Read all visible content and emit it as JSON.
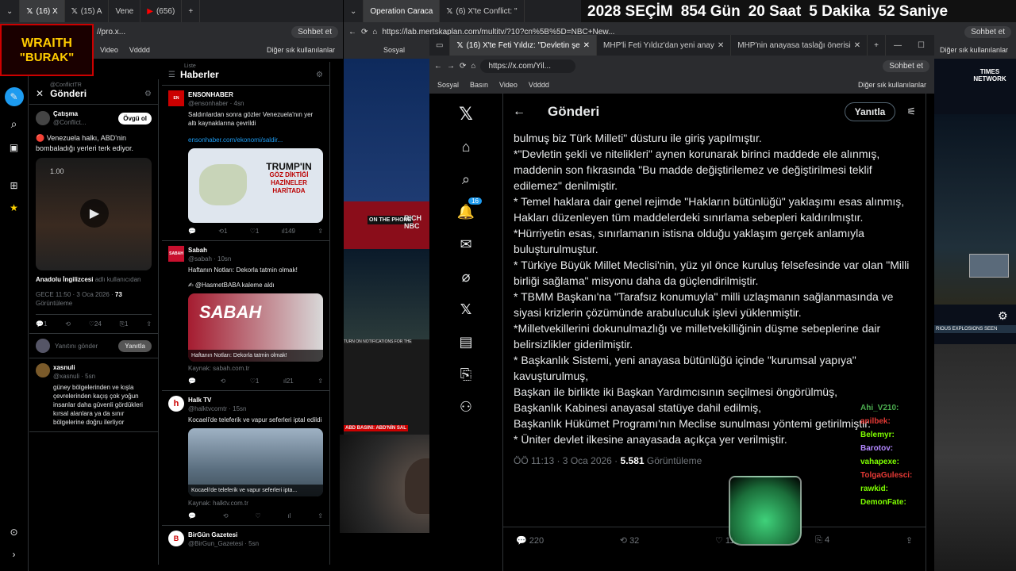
{
  "countdown": {
    "year_label": "2028 SEÇİM",
    "days": "854 Gün",
    "hours": "20 Saat",
    "minutes": "5 Dakika",
    "seconds": "52 Saniye"
  },
  "overlay_logo": {
    "line1": "WRAITH",
    "line2": "\"BURAK\""
  },
  "left_browser": {
    "tabs": [
      "(16) X",
      "(15) A",
      "Vene",
      "(656)"
    ],
    "address": "//pro.x...",
    "chat_button": "Sohbet et",
    "bookmarks": [
      "Video",
      "Vdddd",
      "Diğer sık kullanılanlar"
    ]
  },
  "col1": {
    "header": "Gönderi",
    "top_handle": "@ConflictTR",
    "tweet": {
      "name": "Çatışma",
      "handle": "@Conflict...",
      "follow": "Övgü ol",
      "text": "🔴 Venezuela halkı, ABD'nin bombaladığı yerleri terk ediyor.",
      "video_time": "1.00",
      "credit_name": "Anadolu İngilizcesi",
      "credit_rest": "adlı kullanıcıdan",
      "time": "GECE 11:50 · 3 Oca 2026 · ",
      "views": "73",
      "views_label": "Görüntüleme",
      "reply": "1",
      "like": "24",
      "save": "1"
    },
    "reply_box": {
      "placeholder": "Yanıtını gönder",
      "button": "Yanıtla"
    },
    "reply": {
      "name": "xasnuli",
      "handle": "@xasnuli · 5sn",
      "text": "güney bölgelerinden ve kışla çevrelerinden kaçış çok yoğun insanlar daha güvenli gördükleri kırsal alanlara ya da sınır bölgelerine doğru ilerliyor"
    }
  },
  "col2": {
    "small_label": "Liste",
    "header": "Haberler",
    "tweets": [
      {
        "name": "ENSONHABER",
        "handle": "@ensonhaber · 4sn",
        "text": "Saldırılardan sonra gözler Venezuela'nın yer altı kaynaklarına çevrildi",
        "link": "ensonhaber.com/ekonomi/saldir...",
        "img_text1": "TRUMP'IN",
        "img_text2": "GÖZ DİKTİĞİ HAZİNELER HARİTADA",
        "reply": "1",
        "like": "1",
        "views": "149"
      },
      {
        "name": "Sabah",
        "handle": "@sabah · 10sn",
        "text": "Haftanın Notları: Dekorla tatmin olmak!",
        "mention": "✍ @HasmetBABA kaleme aldı",
        "img_caption": "Haftanın Notları: Dekorla tatmin olmak!",
        "img_logo": "SABAH",
        "source": "Kaynak: sabah.com.tr",
        "like": "1",
        "views": "21"
      },
      {
        "name": "Halk TV",
        "handle": "@halktvcomtr · 15sn",
        "text": "Kocaeli'de teleferik ve vapur seferleri iptal edildi",
        "img_caption": "Kocaeli'de teleferik ve vapur seferleri ipta...",
        "source": "Kaynak: halktv.com.tr"
      },
      {
        "name": "BirGün Gazetesi",
        "handle": "@BirGun_Gazetesi · 5sn"
      }
    ]
  },
  "mid_browser": {
    "tabs": [
      "Operation Caraca",
      "(6) X'te Conflict: \""
    ],
    "address": "https://lab.mertskaplan.com/multitv/?10?cn%5B%5D=NBC+New...",
    "chat_button": "Sohbet et",
    "bookmarks": [
      "Sosyal",
      "Diğer sık kullanılanlar"
    ],
    "tv_labels": {
      "on_the_phone": "ON THE PHONE",
      "nbc": "RICH NBC",
      "ticker": "ABD BASINI: ABD'NİN SAL",
      "notif": "TURN ON NOTIFICATIONS FOR THE"
    }
  },
  "front_browser": {
    "tabs": [
      "(16) X'te Feti Yıldız: \"Devletin şe",
      "MHP'li Feti Yıldız'dan yeni anay",
      "MHP'nin anayasa taslağı önerisi"
    ],
    "address": "https://x.com/Yil...",
    "chat_button": "Sohbet et",
    "bookmarks": [
      "Sosyal",
      "Basın",
      "Video",
      "Vdddd",
      "Diğer sık kullanılanlar"
    ],
    "post_title": "Gönderi",
    "reply_button": "Yanıtla",
    "notif_count": "16",
    "body": [
      "bulmuş biz Türk Milleti\" düsturu ile giriş yapılmıştır.",
      "*\"Devletin şekli ve nitelikleri\" aynen korunarak birinci maddede ele alınmış, maddenin son fıkrasında \"Bu madde değiştirilemez ve değiştirilmesi teklif edilemez\" denilmiştir.",
      "* Temel haklara dair genel rejimde \"Hakların bütünlüğü\" yaklaşımı esas alınmış,",
      "Hakları düzenleyen tüm maddelerdeki sınırlama sebepleri kaldırılmıştır.",
      "*Hürriyetin esas, sınırlamanın istisna olduğu yaklaşım gerçek anlamıyla buluşturulmuştur.",
      "* Türkiye Büyük Millet Meclisi'nin, yüz yıl önce kuruluş felsefesinde var olan \"Milli birliği sağlama\" misyonu daha da güçlendirilmiştir.",
      "* TBMM Başkanı'na \"Tarafsız konumuyla\" milli uzlaşmanın sağlanmasında ve siyasi krizlerin çözümünde arabuluculuk işlevi yüklenmiştir.",
      "*Milletvekillerini dokunulmazlığı ve milletvekilliğinin düşme sebeplerine dair belirsizlikler giderilmiştir.",
      "* Başkanlık Sistemi, yeni anayasa bütünlüğü içinde \"kurumsal yapıya\" kavuşturulmuş,",
      "Başkan ile birlikte iki Başkan Yardımcısının seçilmesi öngörülmüş,",
      "Başkanlık Kabinesi anayasal statüye dahil edilmiş,",
      " Başkanlık Hükümet Programı'nın Meclise sunulması yöntemi getirilmiştir.",
      " * Üniter devlet ilkesine anayasada açıkça yer verilmiştir."
    ],
    "timestamp": "ÖÖ 11:13 · 3 Oca 2026 · ",
    "views": "5.581",
    "views_label": "Görüntüleme",
    "stats": {
      "replies": "220",
      "reposts": "32",
      "likes": "119",
      "bookmarks": "4"
    }
  },
  "chat_names": [
    "Ahi_V210:",
    "anilbek:",
    "Belemyr:",
    "Barotov:",
    "vahapexe:",
    "TolgaGulesci:",
    "rawkid:",
    "DemonFate:"
  ],
  "right_panel": {
    "news_logo": "TIMES NETWORK",
    "explosions": "RIOUS EXPLOSIONS SEEN"
  },
  "colors": {
    "x_bg": "#000000",
    "accent_blue": "#1d9bf0",
    "border": "#2f3336",
    "muted": "#71767b",
    "red": "#e0245e"
  }
}
